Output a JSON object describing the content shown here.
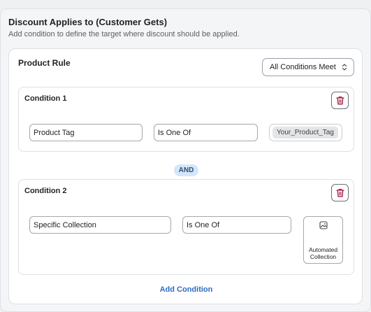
{
  "header": {
    "title": "Discount Applies to (Customer Gets)",
    "subtitle": "Add condition to define the target where discount should be applied."
  },
  "rule": {
    "title": "Product Rule",
    "match_select": "All Conditions Meet"
  },
  "conditions": [
    {
      "title": "Condition 1",
      "field": "Product Tag",
      "operator": "Is One Of",
      "values": [
        "Your_Product_Tag"
      ]
    },
    {
      "title": "Condition 2",
      "field": "Specific Collection",
      "operator": "Is One Of",
      "picker_label": "Automated Collection"
    }
  ],
  "connector": "AND",
  "add_condition_label": "Add Condition",
  "colors": {
    "delete_icon": "#a3173b",
    "link": "#2d6cc0",
    "badge_bg": "#d4e6f9"
  },
  "icons": {
    "delete": "trash-icon",
    "select": "chevron-up-down-icon",
    "collection": "image-icon"
  }
}
